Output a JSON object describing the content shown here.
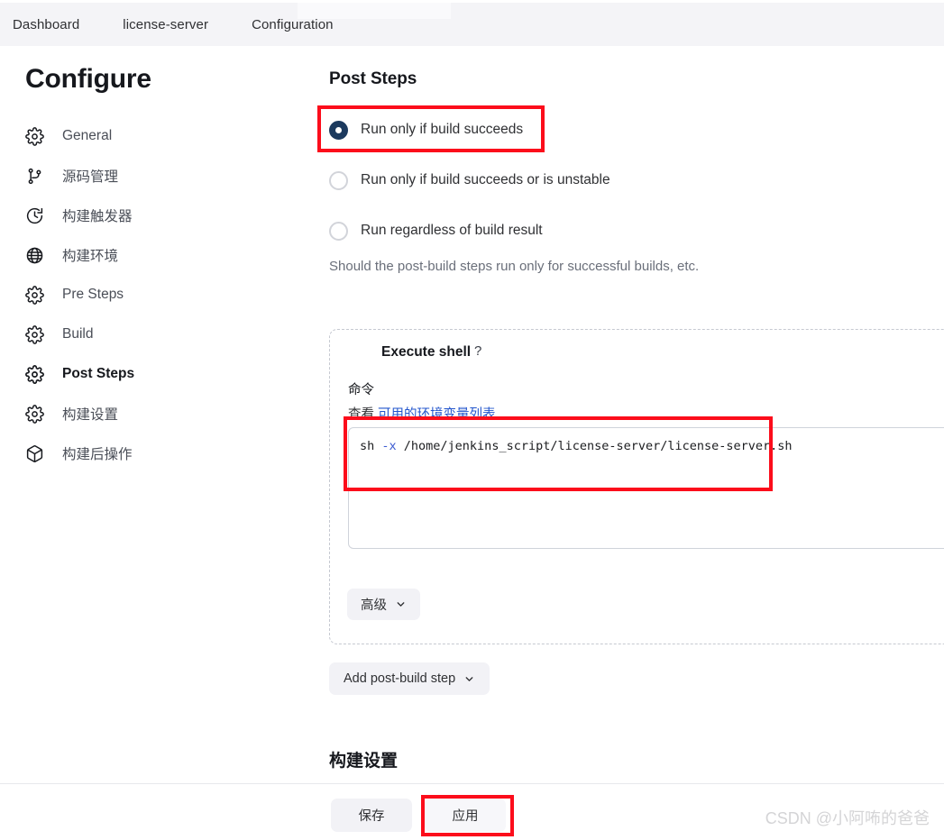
{
  "breadcrumb": {
    "items": [
      {
        "label": "Dashboard"
      },
      {
        "label": "license-server"
      },
      {
        "label": "Configuration"
      }
    ]
  },
  "sidebar": {
    "title": "Configure",
    "items": [
      {
        "label": "General",
        "icon": "gear-icon",
        "active": false
      },
      {
        "label": "源码管理",
        "icon": "git-branch-icon",
        "active": false
      },
      {
        "label": "构建触发器",
        "icon": "clock-icon",
        "active": false
      },
      {
        "label": "构建环境",
        "icon": "globe-icon",
        "active": false
      },
      {
        "label": "Pre Steps",
        "icon": "gear-icon",
        "active": false
      },
      {
        "label": "Build",
        "icon": "gear-icon",
        "active": false
      },
      {
        "label": "Post Steps",
        "icon": "gear-icon",
        "active": true
      },
      {
        "label": "构建设置",
        "icon": "gear-icon",
        "active": false
      },
      {
        "label": "构建后操作",
        "icon": "package-icon",
        "active": false
      }
    ]
  },
  "main": {
    "section_title": "Post Steps",
    "radios": [
      {
        "label": "Run only if build succeeds",
        "checked": true
      },
      {
        "label": "Run only if build succeeds or is unstable",
        "checked": false
      },
      {
        "label": "Run regardless of build result",
        "checked": false
      }
    ],
    "hint": "Should the post-build steps run only for successful builds, etc.",
    "shell": {
      "title": "Execute shell",
      "help_glyph": "?",
      "command_label": "命令",
      "env_prefix": "查看",
      "env_link": "可用的环境变量列表",
      "command_value": "sh -x /home/jenkins_script/license-server/license-server.sh",
      "command_tokens": {
        "cmd": "sh",
        "flag": " -x ",
        "path": "/home/jenkins_script/license-server/license-server.sh"
      },
      "advanced_label": "高级",
      "advanced_chevron": "chevron-down-icon"
    },
    "add_post_build_step_label": "Add post-build step",
    "add_step_chevron": "chevron-down-icon",
    "build_settings_title": "构建设置"
  },
  "footer": {
    "save_label": "保存",
    "apply_label": "应用"
  },
  "watermark": {
    "text": "CSDN @小阿咘的爸爸"
  },
  "colors": {
    "accent_selected": "#1c3a5e",
    "link": "#2255cc",
    "annotation_red": "#fc0d1b",
    "header_bg": "#f4f4f7",
    "button_bg": "#f2f2f6"
  }
}
